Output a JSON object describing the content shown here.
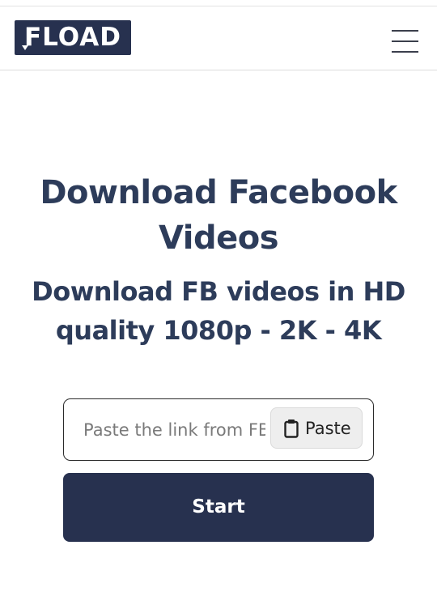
{
  "header": {
    "logo_text": "FLOAD",
    "menu_icon": "hamburger-menu-icon"
  },
  "hero": {
    "title": "Download Facebook Videos",
    "subtitle": "Download FB videos in HD quality 1080p - 2K - 4K"
  },
  "form": {
    "link_placeholder": "Paste the link from FB",
    "link_value": "",
    "paste_label": "Paste",
    "paste_icon": "clipboard-icon",
    "start_label": "Start"
  },
  "colors": {
    "brand_dark": "#27314f",
    "heading": "#2d3c5a"
  }
}
